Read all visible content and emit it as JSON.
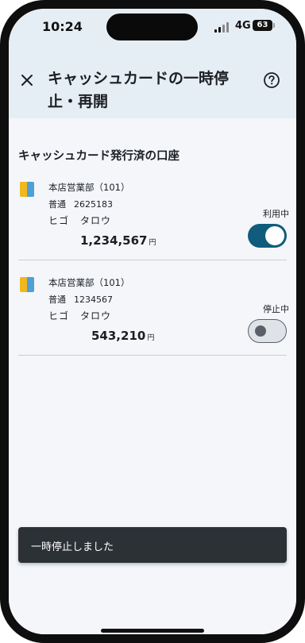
{
  "status_bar": {
    "time": "10:24",
    "network": "4G",
    "battery": "63"
  },
  "header": {
    "title": "キャッシュカードの一時停止・再開",
    "close_icon": "close-icon",
    "help_icon": "help-circle-icon"
  },
  "section_title": "キャッシュカード発行済の口座",
  "accounts": [
    {
      "branch": "本店営業部（101）",
      "type": "普通",
      "number": "2625183",
      "holder_first": "ヒゴ",
      "holder_last": "タロウ",
      "balance": "1,234,567",
      "currency": "円",
      "status": "利用中",
      "enabled": true
    },
    {
      "branch": "本店営業部（101）",
      "type": "普通",
      "number": "1234567",
      "holder_first": "ヒゴ",
      "holder_last": "タロウ",
      "balance": "543,210",
      "currency": "円",
      "status": "停止中",
      "enabled": false
    }
  ],
  "snackbar": {
    "message": "一時停止しました"
  },
  "colors": {
    "header_bg": "#e6eef5",
    "toggle_on": "#0f5c7c",
    "card_yellow": "#f0b81d",
    "card_blue": "#4ea0d6",
    "snackbar_bg": "#2c3136"
  }
}
